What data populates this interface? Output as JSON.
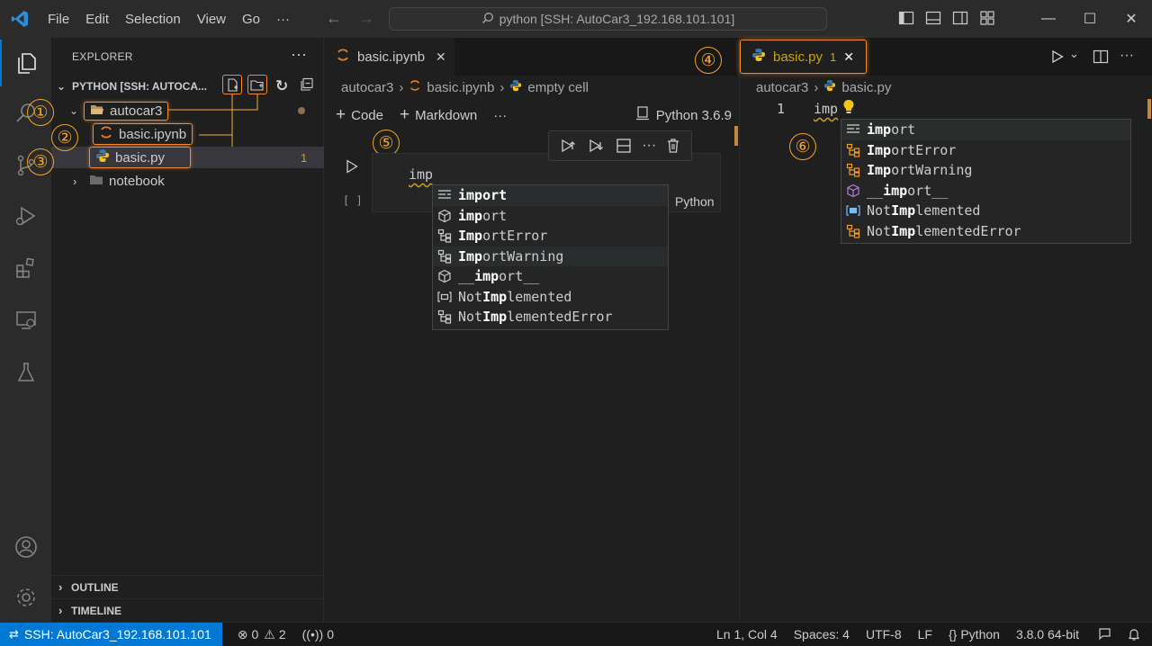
{
  "titlebar": {
    "menu": [
      "File",
      "Edit",
      "Selection",
      "View",
      "Go"
    ],
    "more": "···",
    "search_text": "python [SSH: AutoCar3_192.168.101.101]"
  },
  "sidebar": {
    "title": "EXPLORER",
    "more": "···",
    "section_title": "PYTHON [SSH: AUTOCA...",
    "tree": [
      {
        "label": "autocar3",
        "type": "folder"
      },
      {
        "label": "basic.ipynb",
        "type": "notebook"
      },
      {
        "label": "basic.py",
        "type": "python",
        "badge": "1"
      },
      {
        "label": "notebook",
        "type": "folder"
      }
    ],
    "outline": "OUTLINE",
    "timeline": "TIMELINE"
  },
  "callouts": [
    "①",
    "②",
    "③",
    "④",
    "⑤",
    "⑥"
  ],
  "group1": {
    "tab_label": "basic.ipynb",
    "breadcrumb": [
      "autocar3",
      "basic.ipynb",
      "empty cell"
    ],
    "toolbar": {
      "code": "Code",
      "markdown": "Markdown",
      "more": "···",
      "kernel": "Python 3.6.9"
    },
    "cell_text": "imp",
    "cell_exec": "[ ]",
    "cell_lang": "Python",
    "suggestions": [
      {
        "pre": "",
        "bold": "import",
        "post": "",
        "icon": "keyword"
      },
      {
        "pre": "",
        "bold": "imp",
        "post": "ort",
        "icon": "module"
      },
      {
        "pre": "",
        "bold": "Imp",
        "post": "ortError",
        "icon": "class"
      },
      {
        "pre": "",
        "bold": "Imp",
        "post": "ortWarning",
        "icon": "class"
      },
      {
        "pre": "__",
        "bold": "imp",
        "post": "ort__",
        "icon": "module"
      },
      {
        "pre": "Not",
        "bold": "Imp",
        "post": "lemented",
        "icon": "variable"
      },
      {
        "pre": "Not",
        "bold": "Imp",
        "post": "lementedError",
        "icon": "class"
      }
    ]
  },
  "group2": {
    "tab_label": "basic.py",
    "tab_badge": "1",
    "breadcrumb": [
      "autocar3",
      "basic.py"
    ],
    "line_number": "1",
    "code_text": "imp",
    "suggestions": [
      {
        "pre": "",
        "bold": "imp",
        "post": "ort",
        "icon": "keyword"
      },
      {
        "pre": "",
        "bold": "Imp",
        "post": "ortError",
        "icon": "class"
      },
      {
        "pre": "",
        "bold": "Imp",
        "post": "ortWarning",
        "icon": "class"
      },
      {
        "pre": "__",
        "bold": "imp",
        "post": "ort__",
        "icon": "module"
      },
      {
        "pre": "Not",
        "bold": "Imp",
        "post": "lemented",
        "icon": "variable"
      },
      {
        "pre": "Not",
        "bold": "Imp",
        "post": "lementedError",
        "icon": "class"
      }
    ]
  },
  "statusbar": {
    "remote": "SSH: AutoCar3_192.168.101.101",
    "errors": "0",
    "warnings": "2",
    "ports": "0",
    "position": "Ln 1, Col 4",
    "spaces": "Spaces: 4",
    "encoding": "UTF-8",
    "eol": "LF",
    "language": "Python",
    "interpreter": "3.8.0 64-bit"
  },
  "colors": {
    "accent_remote": "#0078d4",
    "highlight": "#f28a2e",
    "callout": "#f5a623",
    "python_blue": "#3c78aa",
    "python_yellow": "#f5c518",
    "notebook_orange": "#e67e22"
  }
}
